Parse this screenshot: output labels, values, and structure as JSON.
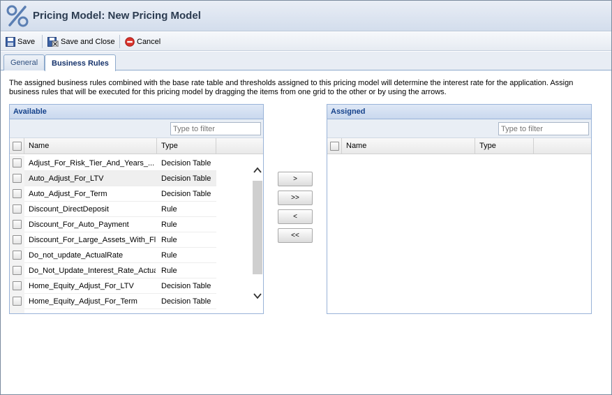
{
  "window": {
    "title": "Pricing Model: New Pricing Model"
  },
  "toolbar": {
    "save_label": "Save",
    "save_close_label": "Save and Close",
    "cancel_label": "Cancel"
  },
  "tabs": [
    {
      "label": "General",
      "active": false
    },
    {
      "label": "Business Rules",
      "active": true
    }
  ],
  "description": "The assigned business rules combined with the base rate table and thresholds assigned to this pricing model will determine the interest rate for the application. Assign business rules that will be executed for this pricing model by dragging the items from one grid to the other or by using the arrows.",
  "available": {
    "title": "Available",
    "filter_placeholder": "Type to filter",
    "columns": {
      "name": "Name",
      "type": "Type"
    },
    "rows": [
      {
        "name": "Adjust_For_Risk_Tier_And_Years_...",
        "type": "Decision Table"
      },
      {
        "name": "Auto_Adjust_For_LTV",
        "type": "Decision Table"
      },
      {
        "name": "Auto_Adjust_For_Term",
        "type": "Decision Table"
      },
      {
        "name": "Discount_DirectDeposit",
        "type": "Rule"
      },
      {
        "name": "Discount_For_Auto_Payment",
        "type": "Rule"
      },
      {
        "name": "Discount_For_Large_Assets_With_Fl",
        "type": "Rule"
      },
      {
        "name": "Do_not_update_ActualRate",
        "type": "Rule"
      },
      {
        "name": "Do_Not_Update_Interest_Rate_Actual",
        "type": "Rule"
      },
      {
        "name": "Home_Equity_Adjust_For_LTV",
        "type": "Decision Table"
      },
      {
        "name": "Home_Equity_Adjust_For_Term",
        "type": "Decision Table"
      }
    ]
  },
  "assigned": {
    "title": "Assigned",
    "filter_placeholder": "Type to filter",
    "columns": {
      "name": "Name",
      "type": "Type"
    }
  },
  "move_buttons": {
    "add_one": ">",
    "add_all": ">>",
    "remove_one": "<",
    "remove_all": "<<"
  },
  "colors": {
    "header_text": "#15428b",
    "tab_active_text": "#15326b",
    "cancel_icon": "#d9322b"
  }
}
